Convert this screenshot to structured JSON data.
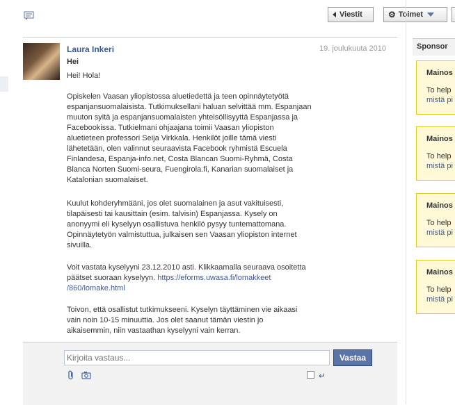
{
  "header": {
    "messages_button": "Viestit",
    "actions_button": "Toimet"
  },
  "message": {
    "sender": "Laura Inkeri",
    "date": "19. joulukuuta 2010",
    "subject": "Hei",
    "paragraphs": [
      "Hei! Hola!",
      "Opiskelen Vaasan yliopistossa aluetiedettä ja teen opinnäytetyötä\nespanjansuomalaisista. Tutkimuksellani haluan selvittää mm. Espanjaan\nmuuton syitä ja espanjansuomalaisten yhteisöllisyyttä Espanjassa ja\nFacebookissa. Tutkielmani ohjaajana toimii Vaasan yliopiston\naluetieteen professori Seija Virkkala. Henkilöt joille tämä viesti\nlähetetään, olen valinnut seuraavista Facebook ryhmistä Escuela\nFinlandesa, Espanja-info.net, Costa Blancan Suomi-Ryhmä, Costa\nBlanca Norten Suomi-seura, Fuengirola.fi, Kanarian suomalaiset ja\nKatalonian suomalaiset.",
      "Kuulut kohderyhmääni, jos olet suomalainen ja asut vakituisesti,\ntilapäisesti tai kausittain (esim. talvisin) Espanjassa. Kysely on\nanonyymi eli kyselyyn osallistuva henkilö pysyy tuntemattomana.\nOpinnäytetyön valmistuttua, julkaisen sen Vaasan yliopiston internet\nsivuilla.",
      "Voit vastata kyselyyni 23.12.2010 asti. Klikkaamalla seuraava osoitetta\npäätset suoraan kyselyyn. ",
      "Toivon, että osallistut tutkimukseeni. Kyselyn täyttäminen vie aikaasi\nvain noin 10-15 minuuttia. Jos olet saanut tämän viestin jo\naikaisemmin, niin vastaathan kyselyyni vain kerran."
    ],
    "link": "https://eforms.uwasa.fi/lomakkeet\n/860/lomake.html"
  },
  "reply": {
    "placeholder": "Kirjoita vastaus...",
    "button": "Vastaa",
    "enter_symbol": "↵"
  },
  "sidebar": {
    "heading": "Sponsor",
    "ads": [
      {
        "title": "Mainos",
        "line1": "To help",
        "line2": "mistä pi"
      },
      {
        "title": "Mainos",
        "line1": "To help",
        "line2": "mistä pi"
      },
      {
        "title": "Mainos",
        "line1": "To help",
        "line2": "mistä pi"
      },
      {
        "title": "Mainos",
        "line1": "To help",
        "line2": "mistä pi"
      }
    ]
  },
  "colors": {
    "link": "#3b5998",
    "reply_button": "#5b74a8",
    "ad_background": "#fff9d7"
  }
}
